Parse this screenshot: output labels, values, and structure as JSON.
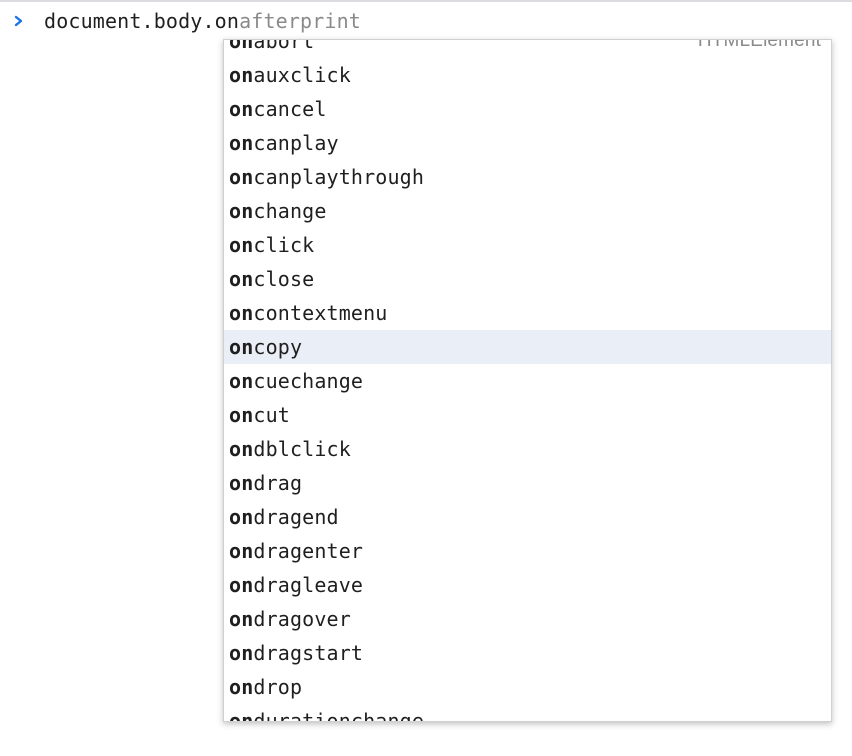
{
  "console": {
    "prompt_icon": "chevron-right-icon",
    "prompt_color": "#1a73e8",
    "typed_text": "document.body.on",
    "ghost_completion": "afterprint"
  },
  "autocomplete": {
    "prefix": "on",
    "selected_color": "#e9eef7",
    "items": [
      {
        "prefix": "on",
        "rest": "abort",
        "type": "HTMLElement"
      },
      {
        "prefix": "on",
        "rest": "auxclick"
      },
      {
        "prefix": "on",
        "rest": "cancel"
      },
      {
        "prefix": "on",
        "rest": "canplay"
      },
      {
        "prefix": "on",
        "rest": "canplaythrough"
      },
      {
        "prefix": "on",
        "rest": "change"
      },
      {
        "prefix": "on",
        "rest": "click"
      },
      {
        "prefix": "on",
        "rest": "close"
      },
      {
        "prefix": "on",
        "rest": "contextmenu"
      },
      {
        "prefix": "on",
        "rest": "copy",
        "selected": true
      },
      {
        "prefix": "on",
        "rest": "cuechange"
      },
      {
        "prefix": "on",
        "rest": "cut"
      },
      {
        "prefix": "on",
        "rest": "dblclick"
      },
      {
        "prefix": "on",
        "rest": "drag"
      },
      {
        "prefix": "on",
        "rest": "dragend"
      },
      {
        "prefix": "on",
        "rest": "dragenter"
      },
      {
        "prefix": "on",
        "rest": "dragleave"
      },
      {
        "prefix": "on",
        "rest": "dragover"
      },
      {
        "prefix": "on",
        "rest": "dragstart"
      },
      {
        "prefix": "on",
        "rest": "drop"
      },
      {
        "prefix": "on",
        "rest": "durationchange"
      }
    ]
  }
}
